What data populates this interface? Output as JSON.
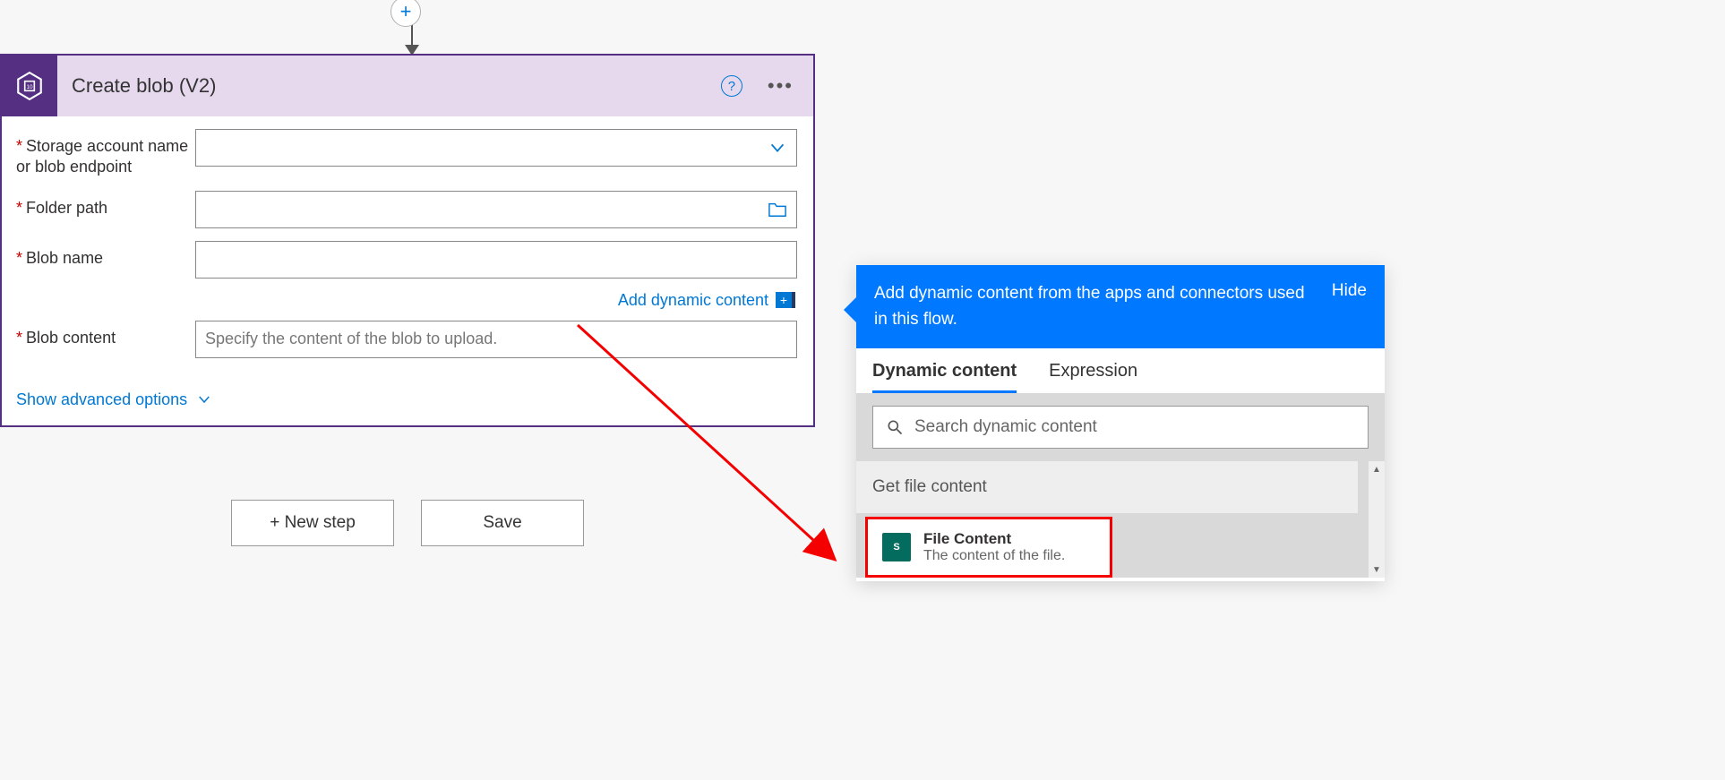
{
  "action": {
    "title": "Create blob (V2)",
    "fields": {
      "storage_label": "Storage account name or blob endpoint",
      "folder_label": "Folder path",
      "blobname_label": "Blob name",
      "blobcontent_label": "Blob content",
      "blobcontent_placeholder": "Specify the content of the blob to upload."
    },
    "dynamic_link": "Add dynamic content",
    "advanced_link": "Show advanced options"
  },
  "buttons": {
    "new_step": "+ New step",
    "save": "Save"
  },
  "popup": {
    "header_text": "Add dynamic content from the apps and connectors used in this flow.",
    "hide": "Hide",
    "tabs": {
      "dynamic": "Dynamic content",
      "expression": "Expression"
    },
    "search_placeholder": "Search dynamic content",
    "group_title": "Get file content",
    "item": {
      "title": "File Content",
      "desc": "The content of the file."
    }
  }
}
